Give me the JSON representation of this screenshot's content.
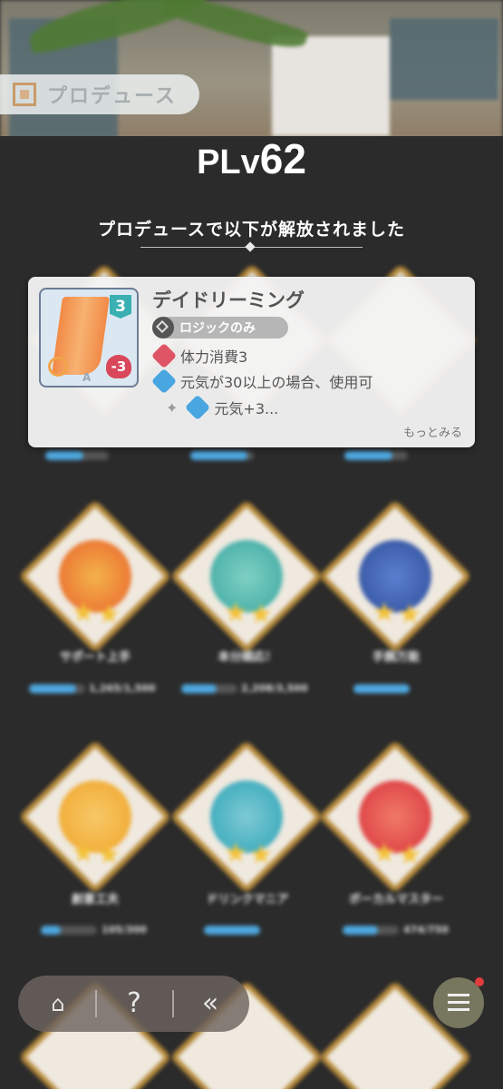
{
  "header": {
    "produce_label": "プロデュース",
    "plv_label": "PLv",
    "plv_value": "62",
    "unlock_text": "プロデュースで以下が解放されました"
  },
  "card_popup": {
    "title": "デイドリーミング",
    "cost": "3",
    "hp_cost": "-3",
    "rarity_letter": "A",
    "tag": "ロジックのみ",
    "effects": [
      {
        "icon": "heart-icon",
        "text": "体力消費3"
      },
      {
        "icon": "genki-icon",
        "text": "元気が30以上の場合、使用可"
      },
      {
        "icon": "genki-icon",
        "text": "元気+3..."
      }
    ],
    "more_label": "もっとみる"
  },
  "badges": [
    {
      "label": "サポート上手",
      "progress": "1,265/1,500",
      "fraction": 0.84,
      "colors": [
        "#e8632b",
        "#f4b24a"
      ]
    },
    {
      "label": "本分順応！",
      "progress": "2,208/3,500",
      "fraction": 0.63,
      "colors": [
        "#3aa7a2",
        "#7fd0c3"
      ]
    },
    {
      "label": "手腕万能",
      "progress": "",
      "fraction": 1.0,
      "colors": [
        "#2f4e9a",
        "#5b7fcf"
      ]
    },
    {
      "label": "創意工夫",
      "progress": "105/300",
      "fraction": 0.35,
      "colors": [
        "#f0a528",
        "#f7c868"
      ]
    },
    {
      "label": "ドリンクマニア",
      "progress": "",
      "fraction": 1.0,
      "colors": [
        "#2da3b6",
        "#7ecad4"
      ]
    },
    {
      "label": "ボーカルマスター",
      "progress": "474/750",
      "fraction": 0.63,
      "colors": [
        "#d9333d",
        "#f07a67"
      ]
    }
  ],
  "nav": {
    "home_icon": "home-icon",
    "help_icon": "help-icon",
    "back_icon": "back-icon",
    "help_glyph": "?",
    "back_glyph": "«",
    "menu_icon": "menu-icon"
  }
}
